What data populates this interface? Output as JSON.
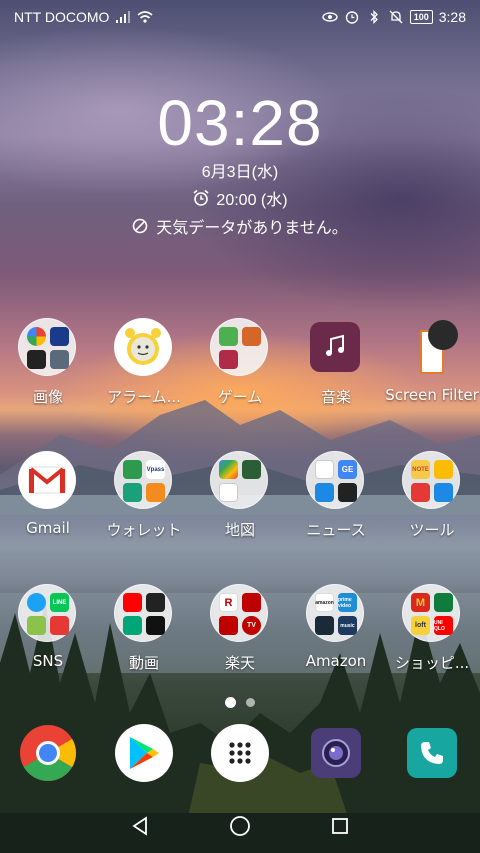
{
  "status_bar": {
    "carrier": "NTT DOCOMO",
    "battery": "100",
    "time": "3:28"
  },
  "clock_widget": {
    "time": "03:28",
    "date": "6月3日(水)",
    "alarm": "20:00 (水)",
    "weather": "天気データがありません。"
  },
  "home_grid": {
    "row1": [
      {
        "label": "画像",
        "type": "folder"
      },
      {
        "label": "アラーム...",
        "type": "app"
      },
      {
        "label": "ゲーム",
        "type": "folder"
      },
      {
        "label": "音楽",
        "type": "app"
      },
      {
        "label": "Screen Filter",
        "type": "app"
      }
    ],
    "row2": [
      {
        "label": "Gmail",
        "type": "app"
      },
      {
        "label": "ウォレット",
        "type": "folder"
      },
      {
        "label": "地図",
        "type": "folder"
      },
      {
        "label": "ニュース",
        "type": "folder"
      },
      {
        "label": "ツール",
        "type": "folder"
      }
    ],
    "row3": [
      {
        "label": "SNS",
        "type": "folder"
      },
      {
        "label": "動画",
        "type": "folder"
      },
      {
        "label": "楽天",
        "type": "folder"
      },
      {
        "label": "Amazon",
        "type": "folder"
      },
      {
        "label": "ショッピ...",
        "type": "folder"
      }
    ]
  },
  "mini_labels": {
    "wallet_vpass": "Vpass",
    "news_ge": "GE",
    "tools_note": "NOTE",
    "sns_line": "LINE",
    "rakuten_r": "R",
    "rakuten_tv": "TV",
    "amazon_amazon": "amazon",
    "amazon_prime": "prime video",
    "amazon_music": "music",
    "shop_m": "M",
    "shop_loft": "loft",
    "shop_uniqlo": "UNI QLO"
  },
  "page_indicator": {
    "pages": 2,
    "active": 1
  },
  "dock": [
    {
      "name": "Chrome"
    },
    {
      "name": "Play Store"
    },
    {
      "name": "App Drawer"
    },
    {
      "name": "Camera"
    },
    {
      "name": "Phone"
    }
  ],
  "colors": {
    "music_bg": "#6b2a4a",
    "phone_bg": "#17a6a0",
    "camera_bg": "#4a3d78"
  }
}
